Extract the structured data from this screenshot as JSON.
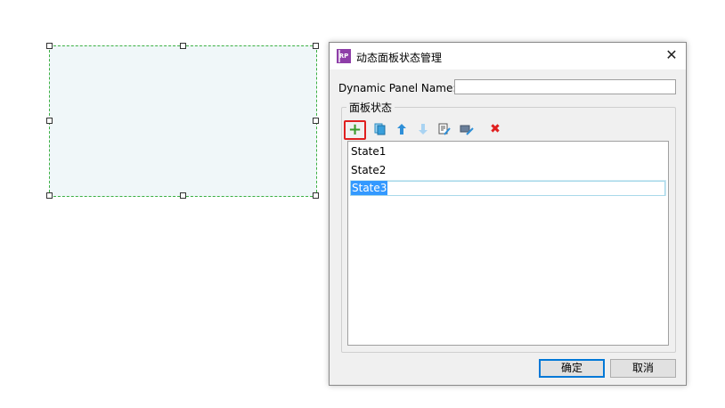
{
  "dialog": {
    "title": "动态面板状态管理",
    "app_icon_text": "RP",
    "close_glyph": "✕",
    "name_label": "Dynamic Panel Name:",
    "name_value": "",
    "group_label": "面板状态",
    "toolbar": {
      "add_icon": "plus-icon",
      "duplicate_icon": "duplicate-icon",
      "move_up_icon": "arrow-up-icon",
      "move_down_icon": "arrow-down-icon",
      "edit_icon": "edit-state-icon",
      "edit_all_icon": "edit-all-states-icon",
      "delete_icon": "delete-icon",
      "add_glyph": "+",
      "delete_glyph": "✖"
    },
    "states": [
      "State1",
      "State2",
      "State3"
    ],
    "selected_state": "State3",
    "ok_label": "确定",
    "cancel_label": "取消"
  },
  "colors": {
    "accent": "#0078d7",
    "highlight_border": "#e02020",
    "selection": "#3399ff",
    "widget_fill": "#f0f7f9",
    "widget_border": "#3cb043"
  }
}
